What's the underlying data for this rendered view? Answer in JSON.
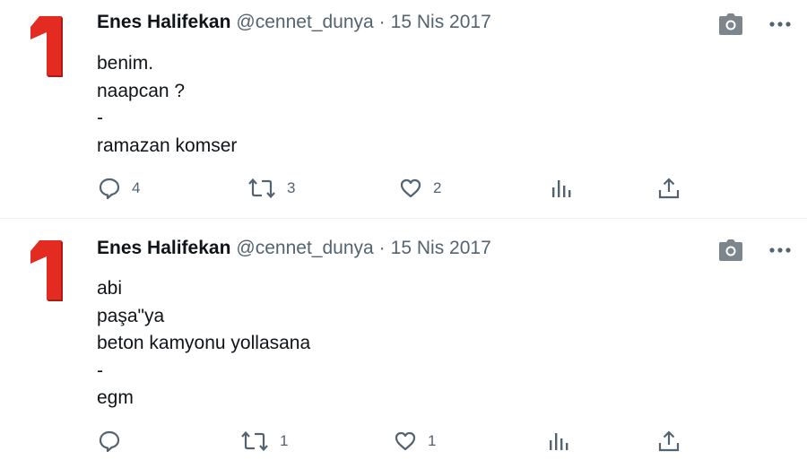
{
  "tweets": [
    {
      "author": {
        "name": "Enes Halifekan",
        "handle": "@cennet_dunya",
        "avatar_text": "1"
      },
      "date": "15 Nis 2017",
      "separator": "·",
      "lines": [
        "benim.",
        "naapcan ?",
        "-",
        "ramazan komser"
      ],
      "actions": {
        "reply": "4",
        "retweet": "3",
        "like": "2"
      }
    },
    {
      "author": {
        "name": "Enes Halifekan",
        "handle": "@cennet_dunya",
        "avatar_text": "1"
      },
      "date": "15 Nis 2017",
      "separator": "·",
      "lines": [
        "abi",
        "paşa\"ya",
        "beton kamyonu yollasana",
        "-",
        "egm"
      ],
      "actions": {
        "reply": "",
        "retweet": "1",
        "like": "1"
      }
    }
  ],
  "icons": {
    "camera": "camera-icon",
    "more": "more-icon",
    "reply": "reply-icon",
    "retweet": "retweet-icon",
    "like": "heart-icon",
    "views": "views-icon",
    "share": "share-icon"
  },
  "colors": {
    "avatar_red": "#e32b22",
    "muted": "#536471",
    "text": "#0f1419",
    "divider": "#eff3f4"
  }
}
